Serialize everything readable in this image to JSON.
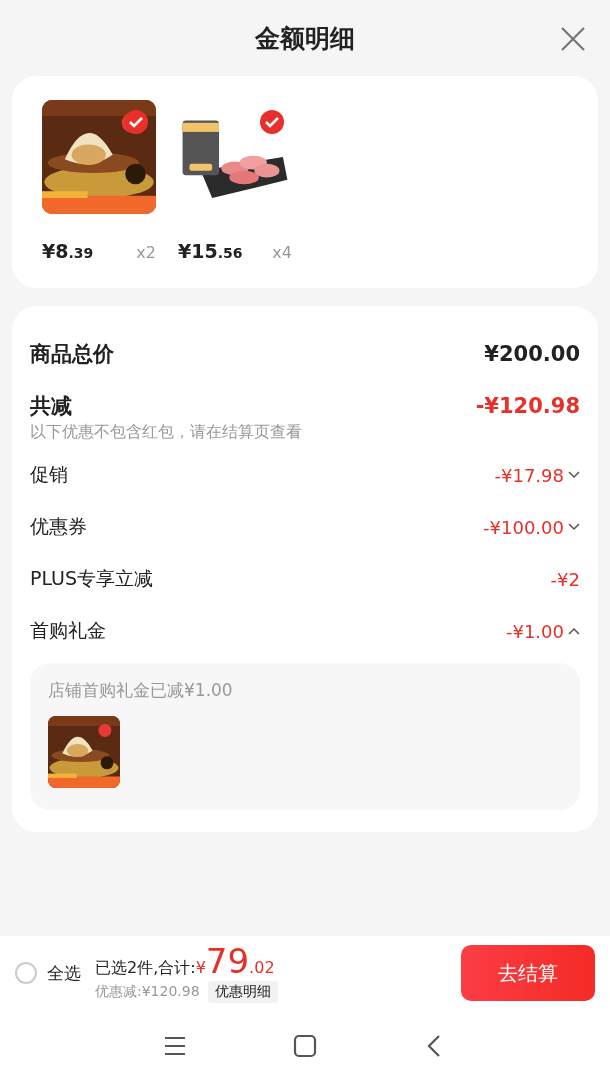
{
  "title": "金额明细",
  "products": [
    {
      "checked": true,
      "price_main": "¥8",
      "price_decimal": ".39",
      "quantity": "x2"
    },
    {
      "checked": true,
      "price_main": "¥15",
      "price_decimal": ".56",
      "quantity": "x4"
    }
  ],
  "summary": {
    "total_label": "商品总价",
    "total_value": "¥200.00",
    "discount_label": "共减",
    "discount_value": "-¥120.98",
    "note": "以下优惠不包含红包，请在结算页查看"
  },
  "discounts": [
    {
      "kind": "expandable",
      "label": "促销",
      "amount": "-¥17.98",
      "expanded": false
    },
    {
      "kind": "expandable",
      "label": "优惠券",
      "amount": "-¥100.00",
      "expanded": false
    },
    {
      "kind": "plain",
      "label": "PLUS专享立减",
      "amount": "-¥2"
    },
    {
      "kind": "expandable",
      "label": "首购礼金",
      "amount": "-¥1.00",
      "expanded": true,
      "detail": {
        "text": "店铺首购礼金已减¥1.00"
      }
    }
  ],
  "footer": {
    "select_all": {
      "label": "全选",
      "checked": false
    },
    "selected_text": "已选2件,合计:",
    "currency": "¥",
    "total_main": "79",
    "total_decimal": ".02",
    "saved": "优惠减:¥120.98",
    "detail_button": "优惠明细",
    "checkout": "去结算"
  }
}
